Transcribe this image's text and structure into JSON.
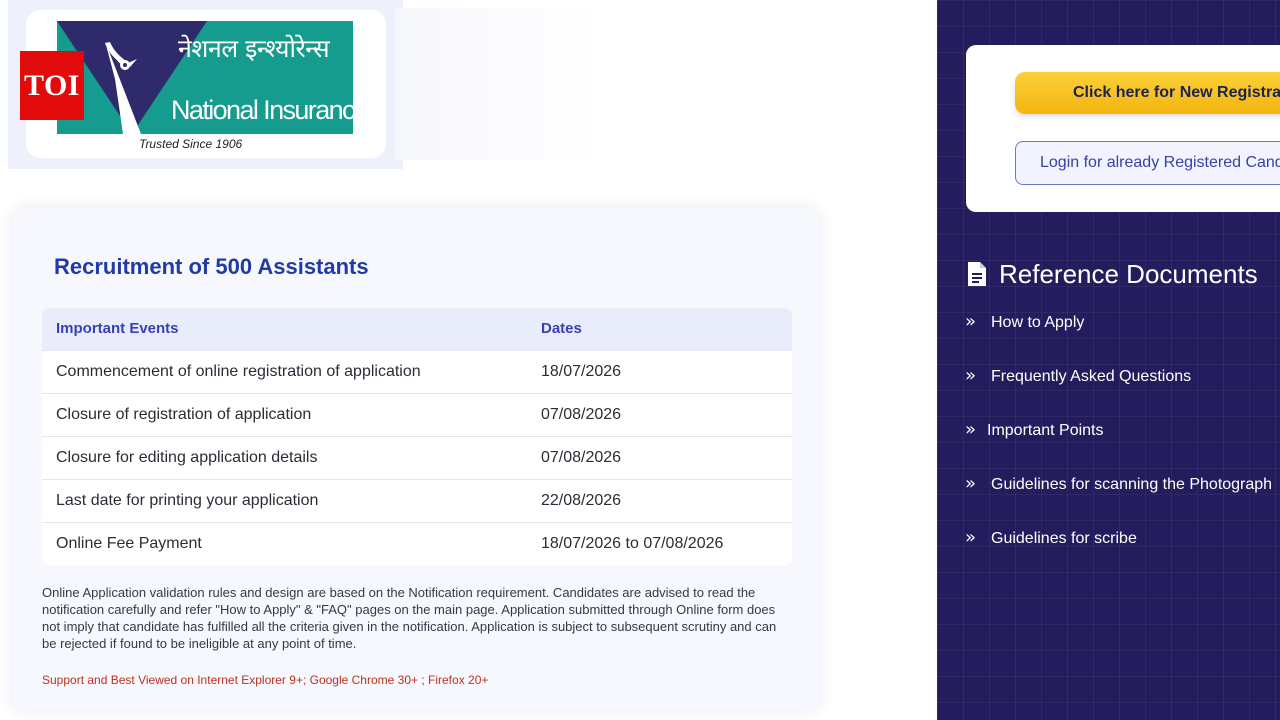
{
  "logo": {
    "badge": "TOI",
    "hindi_name": "नेशनल इन्श्योरेन्स",
    "english_name": "National Insurance",
    "tagline": "Trusted Since 1906"
  },
  "main": {
    "title": "Recruitment of 500 Assistants",
    "table": {
      "headers": [
        "Important Events",
        "Dates"
      ],
      "rows": [
        {
          "event": "Commencement of online registration of application",
          "date": "18/07/2026"
        },
        {
          "event": "Closure of registration of application",
          "date": "07/08/2026"
        },
        {
          "event": "Closure for editing application details",
          "date": "07/08/2026"
        },
        {
          "event": "Last date for printing your application",
          "date": "22/08/2026"
        },
        {
          "event": "Online Fee Payment",
          "date": "18/07/2026 to 07/08/2026"
        }
      ]
    },
    "note": "Online Application validation rules and design are based on the Notification requirement. Candidates are advised to read the notification carefully and refer \"How to Apply\" & \"FAQ\" pages on the main page. Application submitted through Online form does not imply that candidate has fulfilled all the criteria given in the notification. Application is subject to subsequent scrutiny and can be rejected if found to be ineligible at any point of time.",
    "support": "Support and Best Viewed on Internet Explorer 9+; Google Chrome 30+ ; Firefox 20+"
  },
  "sidebar": {
    "new_registration_label": "Click here for New Registration",
    "login_label": "Login for already Registered Candidates",
    "reference_heading": "Reference Documents",
    "reference_icon": "document-icon",
    "reference_links": [
      {
        "label": "How to Apply"
      },
      {
        "label": "Frequently Asked Questions"
      },
      {
        "label": "Important Points"
      },
      {
        "label": "Guidelines for scanning the Photograph"
      },
      {
        "label": "Guidelines for scribe"
      }
    ]
  },
  "colors": {
    "brand_teal": "#169c8e",
    "brand_navy": "#2e2a6b",
    "title_blue": "#2239a8",
    "panel_bg": "#231d5e",
    "cta_yellow": "#f3b40e",
    "toi_red": "#e10b0b"
  }
}
